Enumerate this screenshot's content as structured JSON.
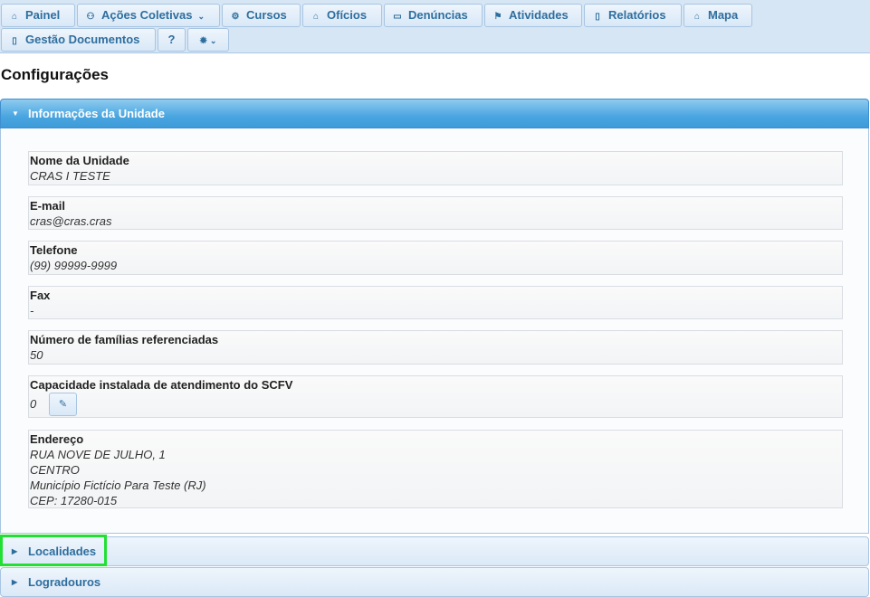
{
  "nav": {
    "items": [
      {
        "label": "Painel",
        "icon": "home-icon",
        "glyph": "⌂"
      },
      {
        "label": "Ações Coletivas",
        "icon": "group-icon",
        "glyph": "⚇",
        "caret": "⌄"
      },
      {
        "label": "Cursos",
        "icon": "gear-icon",
        "glyph": "⚙"
      },
      {
        "label": "Ofícios",
        "icon": "building-icon",
        "glyph": "⌂"
      },
      {
        "label": "Denúncias",
        "icon": "comment-icon",
        "glyph": "▭"
      },
      {
        "label": "Atividades",
        "icon": "flag-icon",
        "glyph": "⚑"
      },
      {
        "label": "Relatórios",
        "icon": "document-icon",
        "glyph": "▯"
      },
      {
        "label": "Mapa",
        "icon": "home-icon",
        "glyph": "⌂"
      },
      {
        "label": "Gestão Documentos",
        "icon": "document-icon",
        "glyph": "▯"
      },
      {
        "label": "?",
        "icon": "",
        "glyph": ""
      },
      {
        "label": "",
        "icon": "settings-icon",
        "glyph": "✹",
        "caret": "⌄"
      }
    ]
  },
  "page": {
    "title": "Configurações"
  },
  "sections": {
    "unit": {
      "label": "Informações da Unidade",
      "tri": "▼"
    },
    "localidades": {
      "label": "Localidades",
      "tri": "▶"
    },
    "logradouros": {
      "label": "Logradouros",
      "tri": "▶"
    }
  },
  "fields": {
    "nome": {
      "label": "Nome da Unidade",
      "value": "CRAS I TESTE"
    },
    "email": {
      "label": "E-mail",
      "value": "cras@cras.cras"
    },
    "telefone": {
      "label": "Telefone",
      "value": "(99) 99999-9999"
    },
    "fax": {
      "label": "Fax",
      "value": "-"
    },
    "familias": {
      "label": "Número de famílias referenciadas",
      "value": "50"
    },
    "capacidade": {
      "label": "Capacidade instalada de atendimento do SCFV",
      "value": "0",
      "edit_glyph": "✎"
    },
    "endereco": {
      "label": "Endereço",
      "lines": [
        "RUA NOVE DE JULHO, 1",
        "CENTRO",
        "Município Fictício Para Teste (RJ)",
        "CEP: 17280-015"
      ]
    }
  },
  "colors": {
    "accent": "#2e6e9e",
    "active_header": "#4aa6e0",
    "focus": "#22e033"
  }
}
